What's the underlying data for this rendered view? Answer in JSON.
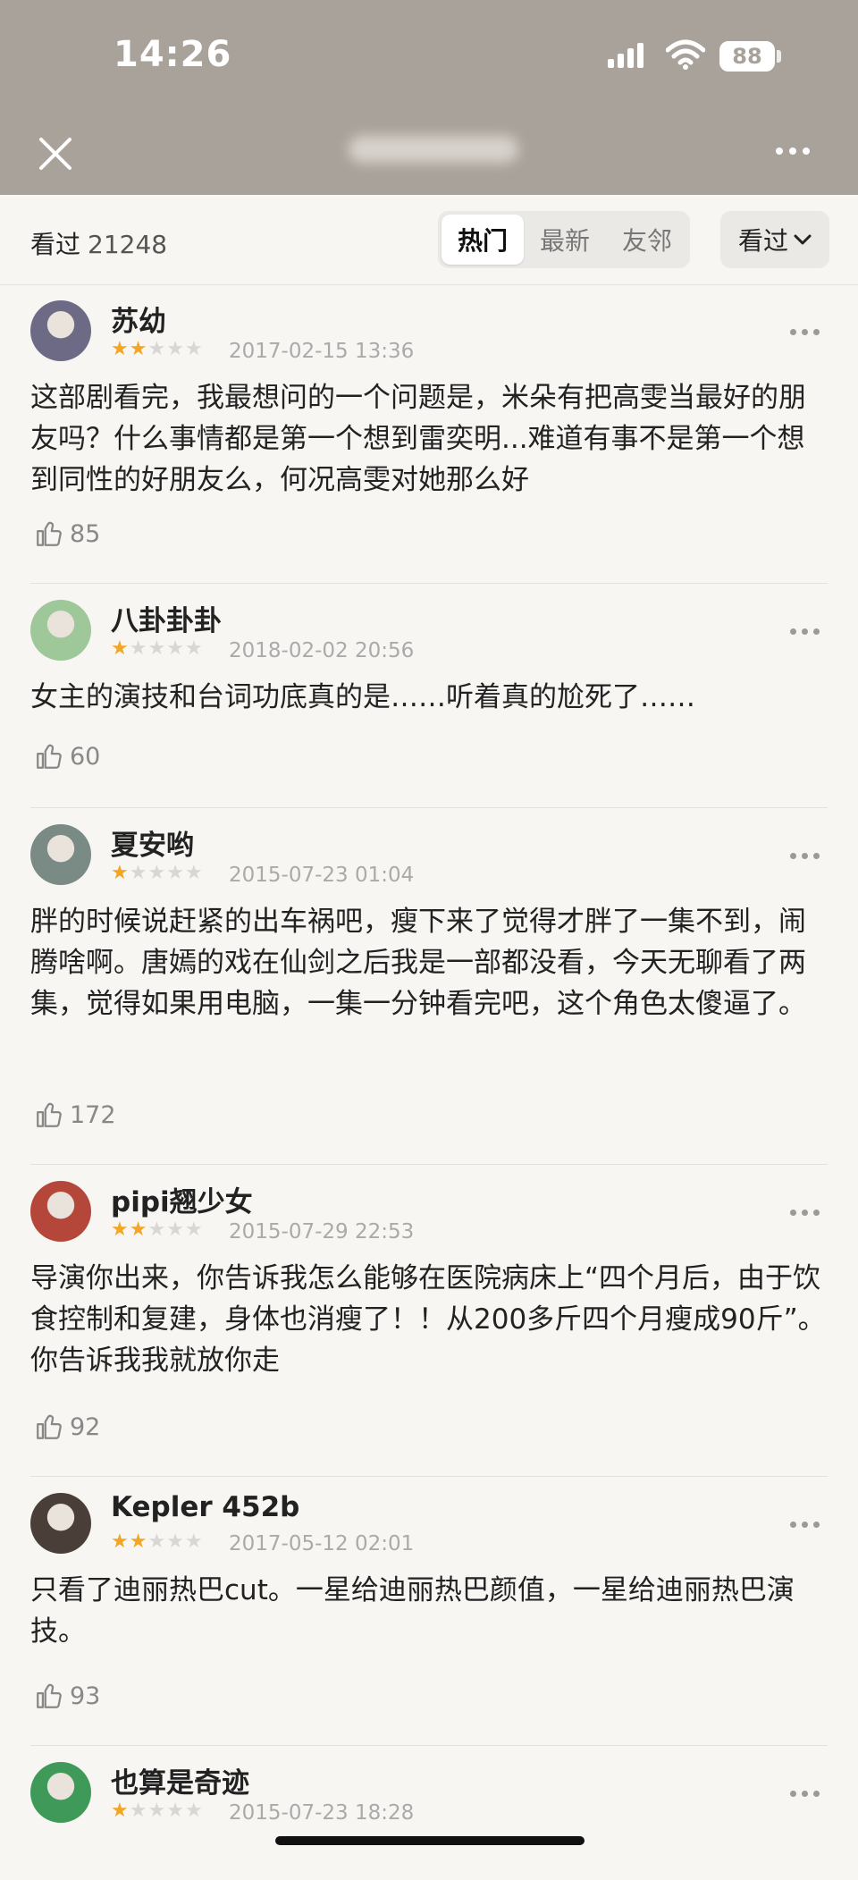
{
  "status": {
    "time": "14:26",
    "battery": "88"
  },
  "filter": {
    "seen_label": "看过",
    "seen_count": "21248",
    "tabs": [
      {
        "label": "热门",
        "active": true
      },
      {
        "label": "最新",
        "active": false
      },
      {
        "label": "友邻",
        "active": false
      }
    ],
    "dropdown_label": "看过"
  },
  "reviews": [
    {
      "user": "苏幼",
      "rating": 2,
      "date": "2017-02-15 13:36",
      "content": "这部剧看完，我最想问的一个问题是，米朵有把高雯当最好的朋友吗？什么事情都是第一个想到雷奕明...难道有事不是第一个想到同性的好朋友么，何况高雯对她那么好",
      "likes": "85",
      "avatar_color": "#6d6a86"
    },
    {
      "user": "八卦卦卦",
      "rating": 1,
      "date": "2018-02-02 20:56",
      "content": "女主的演技和台词功底真的是……听着真的尬死了……",
      "likes": "60",
      "avatar_color": "#9ec79a"
    },
    {
      "user": "夏安哟",
      "rating": 1,
      "date": "2015-07-23 01:04",
      "content": "胖的时候说赶紧的出车祸吧，瘦下来了觉得才胖了一集不到，闹腾啥啊。唐嫣的戏在仙剑之后我是一部都没看，今天无聊看了两集，觉得如果用电脑，一集一分钟看完吧，这个角色太傻逼了。",
      "likes": "172",
      "avatar_color": "#7a8a84"
    },
    {
      "user": "pipi翘少女",
      "rating": 2,
      "date": "2015-07-29 22:53",
      "content": "导演你出来，你告诉我怎么能够在医院病床上“四个月后，由于饮食控制和复建，身体也消瘦了！！从200多斤四个月瘦成90斤”。你告诉我我就放你走",
      "likes": "92",
      "avatar_color": "#b5473a"
    },
    {
      "user": "Kepler 452b",
      "rating": 2,
      "date": "2017-05-12 02:01",
      "content": "只看了迪丽热巴cut。一星给迪丽热巴颜值，一星给迪丽热巴演技。",
      "likes": "93",
      "avatar_color": "#4a3f38"
    },
    {
      "user": "也算是奇迹",
      "rating": 1,
      "date": "2015-07-23 18:28",
      "content": "",
      "likes": "",
      "avatar_color": "#3f9a5a"
    }
  ]
}
